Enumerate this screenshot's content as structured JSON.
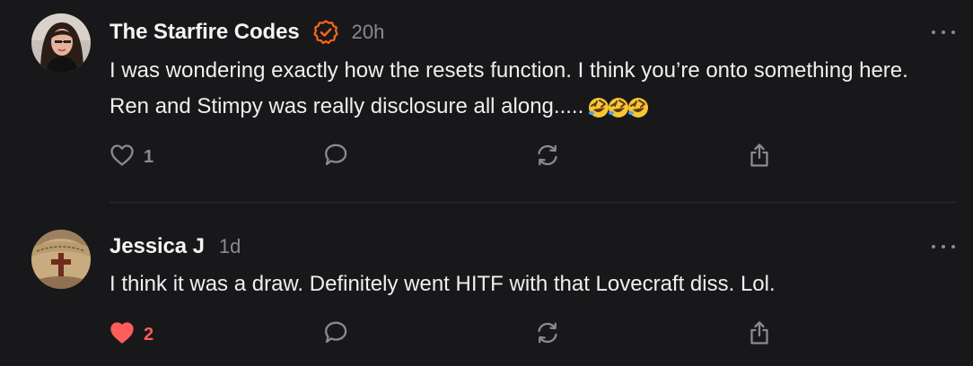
{
  "comments": [
    {
      "author": "The Starfire Codes",
      "verified": true,
      "timestamp": "20h",
      "text": "I was wondering exactly how the resets function. I think you’re onto something here. Ren and Stimpy was really disclosure all along.....",
      "emojis": [
        "rolling-on-floor-laughing",
        "rolling-on-floor-laughing",
        "rolling-on-floor-laughing"
      ],
      "likes": "1",
      "liked": false
    },
    {
      "author": "Jessica J",
      "verified": false,
      "timestamp": "1d",
      "text": "I think it was a draw. Definitely went HITF with that Lovecraft diss. Lol.",
      "likes": "2",
      "liked": true
    }
  ],
  "icons": {
    "like": "heart-outline-icon",
    "liked": "heart-filled-icon",
    "reply": "speech-bubble-icon",
    "restack": "restack-arrows-icon",
    "share": "share-upload-icon",
    "more": "more-dots-icon",
    "verified": "verified-check-icon"
  },
  "colors": {
    "background": "#18181a",
    "muted": "#8b8b8f",
    "verified": "#ff6719",
    "liked": "#ff5c5c"
  }
}
